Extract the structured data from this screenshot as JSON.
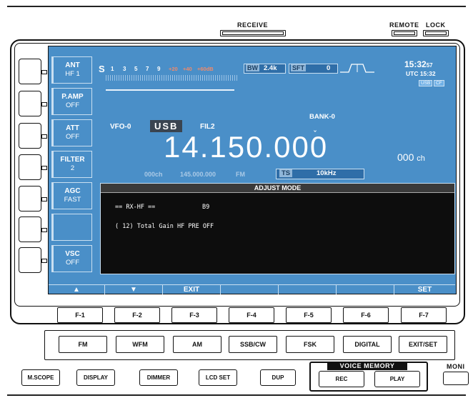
{
  "top": {
    "receive_label": "RECEIVE",
    "remote_label": "REMOTE",
    "lock_label": "LOCK"
  },
  "screen": {
    "side_buttons": [
      {
        "title": "ANT",
        "value": "HF 1"
      },
      {
        "title": "P.AMP",
        "value": "OFF"
      },
      {
        "title": "ATT",
        "value": "OFF"
      },
      {
        "title": "FILTER",
        "value": "2"
      },
      {
        "title": "AGC",
        "value": "FAST"
      },
      {
        "title": "",
        "value": ""
      },
      {
        "title": "VSC",
        "value": "OFF"
      }
    ],
    "meter": {
      "s_label": "S",
      "scale": [
        "1",
        "3",
        "5",
        "7",
        "9"
      ],
      "over_scale": [
        "+20",
        "+40",
        "+60dB"
      ]
    },
    "bw_label": "BW",
    "bw_value": "2.4k",
    "sft_label": "SFT",
    "sft_value": "0",
    "clock": "15:32",
    "clock_sec": "57",
    "utc": "UTC 15:32",
    "badges": [
      "USB",
      "CF"
    ],
    "vfo": "VFO-0",
    "mode": "USB",
    "filter": "FIL2",
    "bank": "BANK-0",
    "frequency": "14.150.000",
    "channel": "000",
    "channel_unit": "ch",
    "sub_channel": "000ch",
    "sub_freq": "145.000.000",
    "sub_mode": "FM",
    "ts_label": "TS",
    "ts_value": "10kHz",
    "adjust": {
      "title": "ADJUST MODE",
      "line1_left": "== RX-HF ==",
      "line1_right": "B9",
      "line2": "( 12) Total Gain HF PRE OFF"
    },
    "function_tabs": [
      "▲",
      "▼",
      "EXIT",
      "",
      "",
      "",
      "SET"
    ]
  },
  "f_keys": [
    "F-1",
    "F-2",
    "F-3",
    "F-4",
    "F-5",
    "F-6",
    "F-7"
  ],
  "mode_keys": [
    "FM",
    "WFM",
    "AM",
    "SSB/CW",
    "FSK",
    "DIGITAL",
    "EXIT/SET"
  ],
  "bottom_keys": [
    "M.SCOPE",
    "DISPLAY",
    "DIMMER",
    "LCD SET",
    "DUP"
  ],
  "voice_memory": {
    "title": "VOICE MEMORY",
    "rec": "REC",
    "play": "PLAY"
  },
  "moni_label": "MONI"
}
